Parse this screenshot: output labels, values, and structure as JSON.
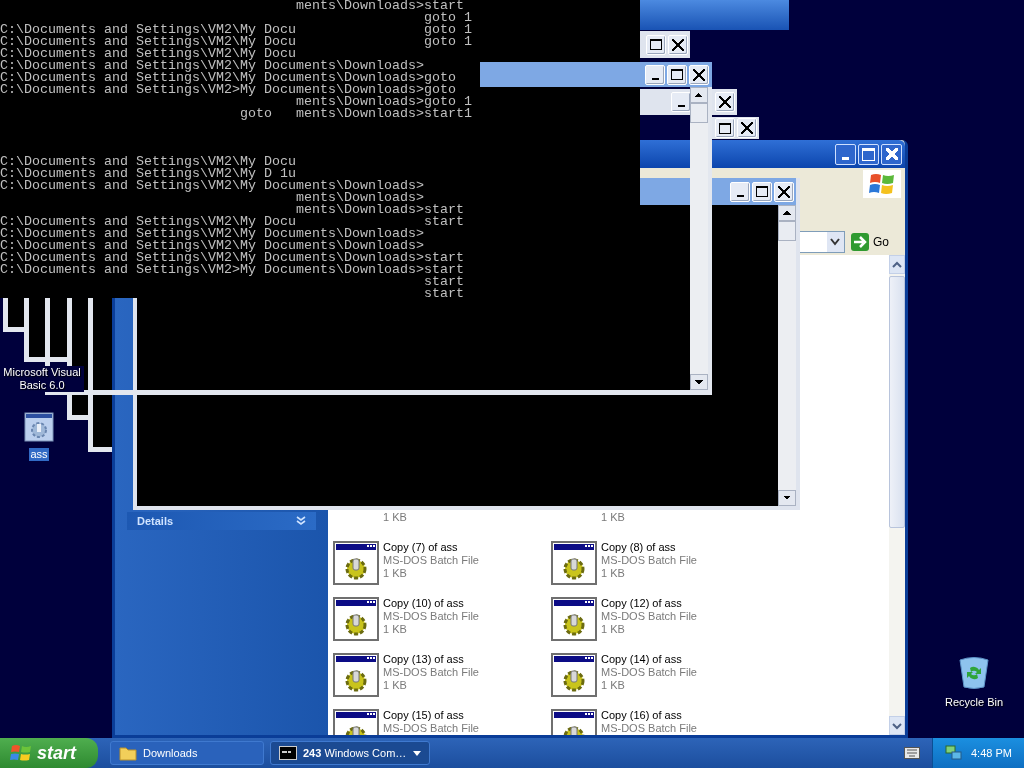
{
  "console": {
    "lines_top": [
      "                                     ments\\Downloads>start",
      "                                                     goto 1",
      "C:\\Documents and Settings\\VM2\\My Docu                goto 1",
      "C:\\Documents and Settings\\VM2\\My Docu                goto 1",
      "C:\\Documents and Settings\\VM2\\My Docu",
      "C:\\Documents and Settings\\VM2\\My Documents\\Downloads>",
      "C:\\Documents and Settings\\VM2\\My Documents\\Downloads>goto",
      "C:\\Documents and Settings\\VM2>My Documents\\Downloads>goto",
      "                                     ments\\Downloads>goto 1",
      "                              goto   ments\\Downloads>start1"
    ],
    "lines_bottom": [
      "C:\\Documents and Settings\\VM2\\My Docu",
      "C:\\Documents and Settings\\VM2\\My D 1u",
      "C:\\Documents and Settings\\VM2\\My Documents\\Downloads>",
      "                                     ments\\Downloads>",
      "                                     ments\\Downloads>start",
      "C:\\Documents and Settings\\VM2\\My Docu                start",
      "C:\\Documents and Settings\\VM2\\My Documents\\Downloads>",
      "C:\\Documents and Settings\\VM2\\My Documents\\Downloads>",
      "C:\\Documents and Settings\\VM2\\My Documents\\Downloads>start",
      "C:\\Documents and Settings\\VM2>My Documents\\Downloads>start",
      "                                                     start",
      "                                                     start"
    ]
  },
  "desktop_icons": [
    {
      "label": "Microsoft Visual Basic 6.0",
      "kind": "program",
      "selected": false
    },
    {
      "label": "ass",
      "kind": "batch",
      "selected": true
    },
    {
      "label": "Recycle Bin",
      "kind": "recycle",
      "selected": false
    }
  ],
  "explorer": {
    "go_button": "Go",
    "details_header": "Details",
    "files": [
      {
        "size": "1 KB"
      },
      {
        "size": "1 KB"
      },
      {
        "name": "Copy (7) of ass",
        "type": "MS-DOS Batch File",
        "size": "1 KB"
      },
      {
        "name": "Copy (8) of ass",
        "type": "MS-DOS Batch File",
        "size": "1 KB"
      },
      {
        "name": "Copy (10) of ass",
        "type": "MS-DOS Batch File",
        "size": "1 KB"
      },
      {
        "name": "Copy (12) of ass",
        "type": "MS-DOS Batch File",
        "size": "1 KB"
      },
      {
        "name": "Copy (13) of ass",
        "type": "MS-DOS Batch File",
        "size": "1 KB"
      },
      {
        "name": "Copy (14) of ass",
        "type": "MS-DOS Batch File",
        "size": "1 KB"
      },
      {
        "name": "Copy (15) of ass",
        "type": "MS-DOS Batch File"
      },
      {
        "name": "Copy (16) of ass",
        "type": "MS-DOS Batch File"
      }
    ]
  },
  "taskbar": {
    "start": "start",
    "tasks": [
      {
        "label": "Downloads",
        "kind": "folder",
        "grouped": false
      },
      {
        "label": "**243** Windows Com…",
        "kind": "console",
        "grouped": true
      }
    ],
    "clock": "4:48 PM"
  }
}
